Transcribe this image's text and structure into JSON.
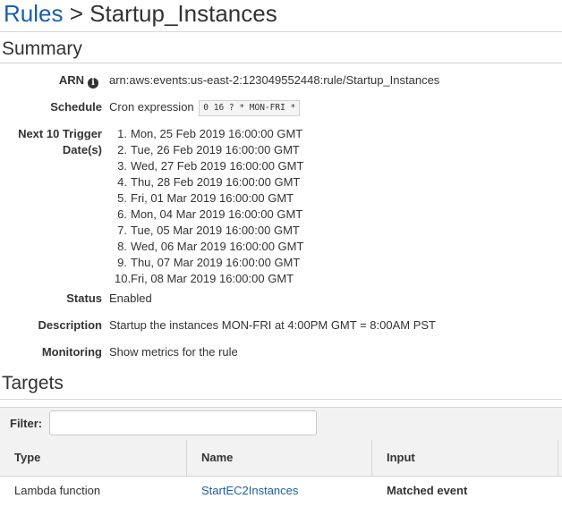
{
  "header": {
    "breadcrumb_link": "Rules",
    "separator": ">",
    "current": "Startup_Instances"
  },
  "summary": {
    "title": "Summary",
    "arn": {
      "label": "ARN",
      "value": "arn:aws:events:us-east-2:123049552448:rule/Startup_Instances",
      "icon": "info-icon"
    },
    "schedule": {
      "label": "Schedule",
      "prefix": "Cron expression",
      "expression": "0 16 ? * MON-FRI *"
    },
    "next_dates": {
      "label_line1": "Next 10 Trigger",
      "label_line2": "Date(s)",
      "items": [
        {
          "n": "1.",
          "date": "Mon, 25 Feb 2019 16:00:00 GMT"
        },
        {
          "n": "2.",
          "date": "Tue, 26 Feb 2019 16:00:00 GMT"
        },
        {
          "n": "3.",
          "date": "Wed, 27 Feb 2019 16:00:00 GMT"
        },
        {
          "n": "4.",
          "date": "Thu, 28 Feb 2019 16:00:00 GMT"
        },
        {
          "n": "5.",
          "date": "Fri, 01 Mar 2019 16:00:00 GMT"
        },
        {
          "n": "6.",
          "date": "Mon, 04 Mar 2019 16:00:00 GMT"
        },
        {
          "n": "7.",
          "date": "Tue, 05 Mar 2019 16:00:00 GMT"
        },
        {
          "n": "8.",
          "date": "Wed, 06 Mar 2019 16:00:00 GMT"
        },
        {
          "n": "9.",
          "date": "Thu, 07 Mar 2019 16:00:00 GMT"
        },
        {
          "n": "10.",
          "date": "Fri, 08 Mar 2019 16:00:00 GMT"
        }
      ]
    },
    "status": {
      "label": "Status",
      "value": "Enabled",
      "color": "#1d8102"
    },
    "description": {
      "label": "Description",
      "value": "Startup the instances MON-FRI at 4:00PM GMT = 8:00AM PST"
    },
    "monitoring": {
      "label": "Monitoring",
      "link": "Show metrics for the rule"
    }
  },
  "targets": {
    "title": "Targets",
    "filter": {
      "label": "Filter:",
      "value": "",
      "placeholder": ""
    },
    "columns": [
      "Type",
      "Name",
      "Input"
    ],
    "rows": [
      {
        "type": "Lambda function",
        "name": "StartEC2Instances",
        "input": "Matched event"
      }
    ]
  },
  "colors": {
    "link": "#1a5fa8",
    "enabled": "#1d8102",
    "header_bg": "#f2f2f2"
  }
}
